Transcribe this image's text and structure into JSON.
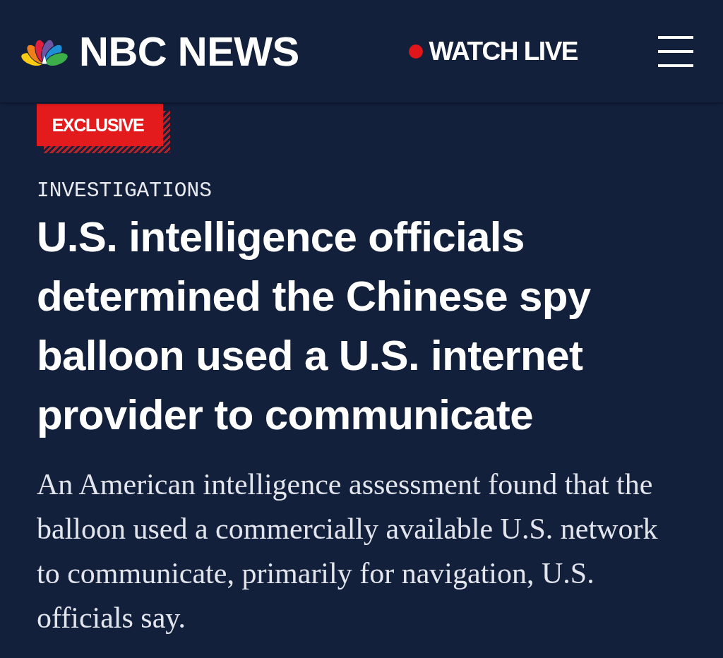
{
  "header": {
    "logo_text": "NBC NEWS",
    "live_link": "WATCH LIVE"
  },
  "article": {
    "badge": "EXCLUSIVE",
    "section": "INVESTIGATIONS",
    "headline": "U.S. intelligence officials determined the Chinese spy balloon used a U.S. internet provider to communicate",
    "summary": "An American intelligence assessment found that the balloon used a commercially available U.S. network to communicate, primarily for navigation, U.S. officials say."
  }
}
